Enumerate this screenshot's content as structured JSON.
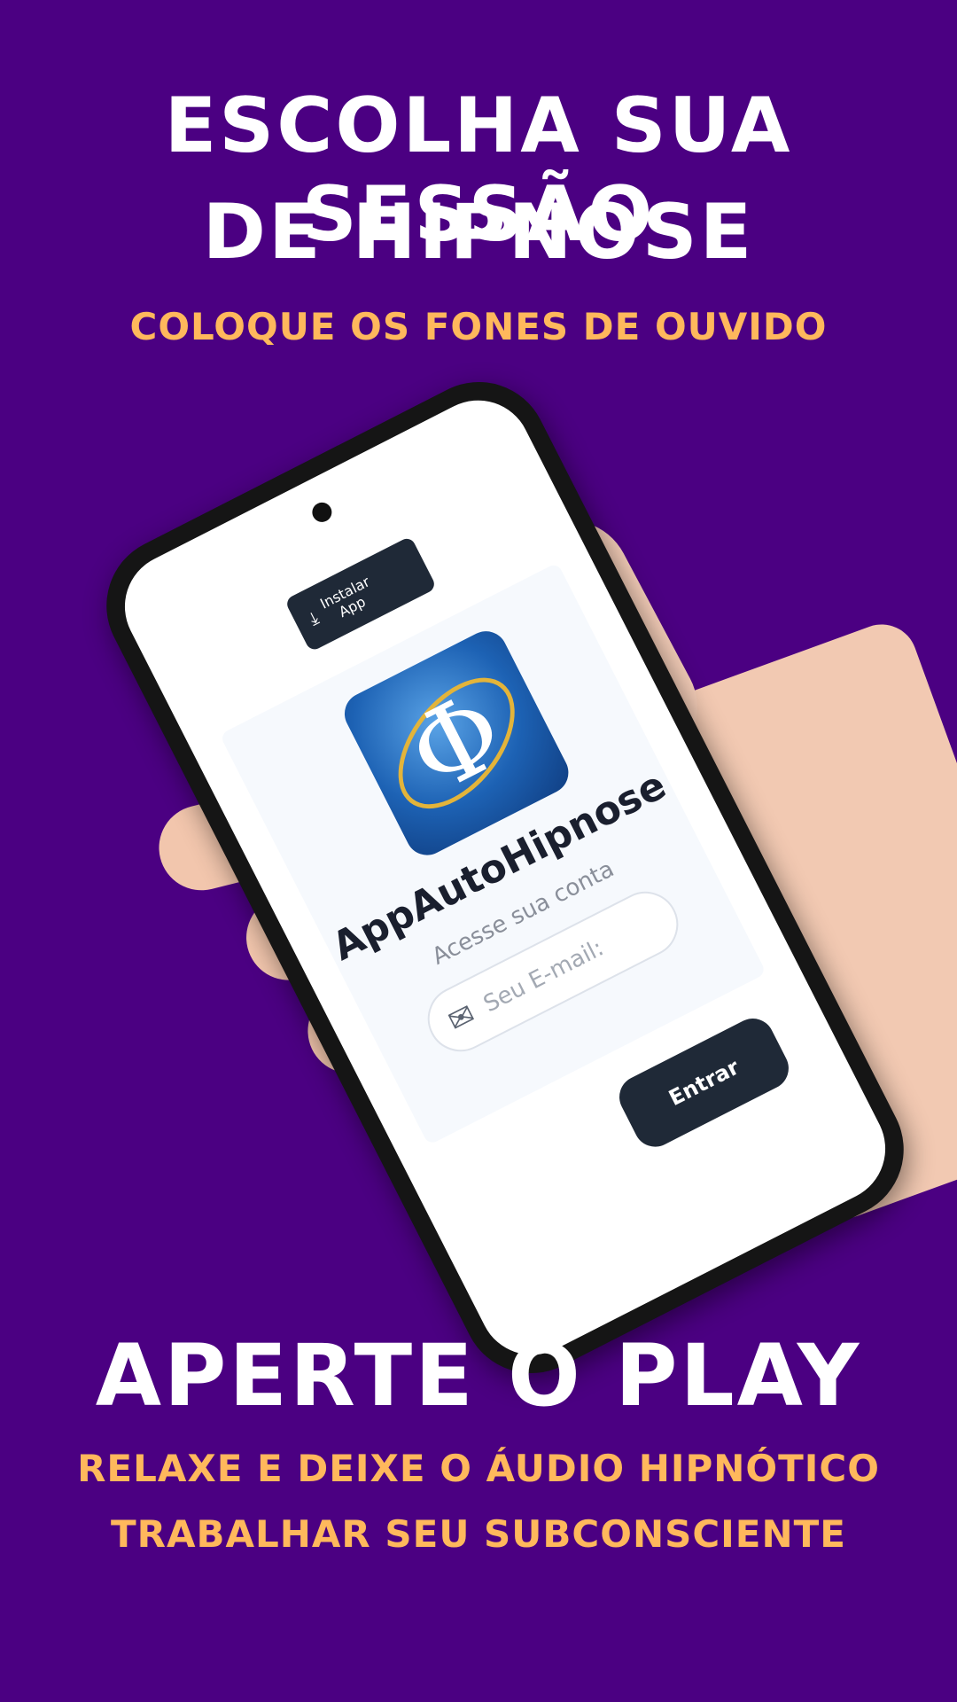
{
  "header": {
    "title_line1": "ESCOLHA SUA SESSÃO",
    "title_line2": "DE HIPNOSE",
    "subtitle": "COLOQUE OS FONES DE OUVIDO"
  },
  "phone_screen": {
    "install_button": {
      "label_line1": "Instalar",
      "label_line2": "App",
      "icon": "download-icon"
    },
    "logo_symbol": "Φ",
    "app_name": "AppAutoHipnose",
    "access_text": "Acesse sua conta",
    "email_placeholder": "Seu E-mail:",
    "email_icon": "mail-icon",
    "submit_label": "Entrar"
  },
  "footer": {
    "title": "APERTE O PLAY",
    "line1": "RELAXE E DEIXE O ÁUDIO HIPNÓTICO",
    "line2": "TRABALHAR SEU SUBCONSCIENTE"
  },
  "colors": {
    "background": "#4b0082",
    "title": "#ffffff",
    "accent": "#ffb85c",
    "button": "#1f2937"
  }
}
